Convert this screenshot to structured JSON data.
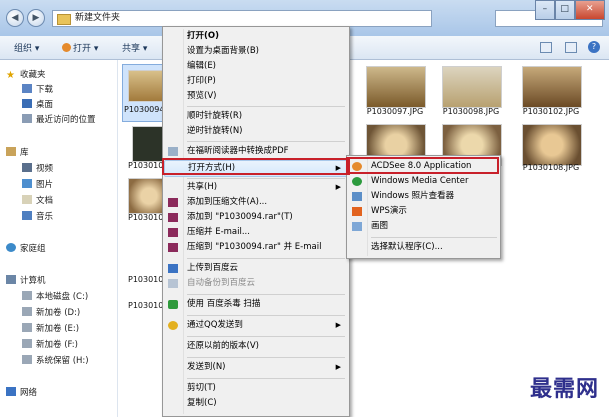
{
  "window": {
    "address": "新建文件夹",
    "back_glyph": "◀",
    "forward_glyph": "▶",
    "minimize_glyph": "–",
    "maximize_glyph": "□",
    "close_glyph": "✕"
  },
  "toolbar": {
    "organize": "组织 ▾",
    "open": "打开 ▾",
    "share": "共享 ▾"
  },
  "sidebar": {
    "favorites": "收藏夹",
    "downloads": "下载",
    "desktop": "桌面",
    "recent": "最近访问的位置",
    "libraries": "库",
    "videos": "视频",
    "pictures": "图片",
    "documents": "文档",
    "music": "音乐",
    "homegroup": "家庭组",
    "computer": "计算机",
    "drive_c": "本地磁盘 (C:)",
    "drive_d": "新加卷 (D:)",
    "drive_e": "新加卷 (E:)",
    "drive_f": "新加卷 (F:)",
    "drive_h": "系统保留 (H:)",
    "network": "网络"
  },
  "files": {
    "f1": "P1030094.JPG",
    "f2": "P1030097.JPG",
    "f3": "P1030098.JPG",
    "f4": "P1030102.JPG",
    "f5": "P103010",
    "f6": "P1030108.JPG",
    "f7": "P103010",
    "f8": "P103010",
    "f9": "P103010"
  },
  "context_menu": {
    "open": "打开(O)",
    "set_bg": "设置为桌面背景(B)",
    "edit": "编辑(E)",
    "print": "打印(P)",
    "preview": "预览(V)",
    "rotate_cw": "顺时针旋转(R)",
    "rotate_ccw": "逆时针旋转(N)",
    "to_pdf": "在福昕阅读器中转换成PDF",
    "open_with": "打开方式(H)",
    "share": "共享(H)",
    "add_archive": "添加到压缩文件(A)...",
    "add_rar": "添加到 \"P1030094.rar\"(T)",
    "compress_email": "压缩并 E-mail...",
    "compress_rar_email": "压缩到 \"P1030094.rar\" 并 E-mail",
    "upload_baidu": "上传到百度云",
    "auto_backup": "自动备份到百度云",
    "baidu_scan": "使用 百度杀毒 扫描",
    "send_qq": "通过QQ发送到",
    "restore": "还原以前的版本(V)",
    "send_to": "发送到(N)",
    "cut": "剪切(T)",
    "copy": "复制(C)"
  },
  "submenu": {
    "acdsee": "ACDSee 8.0 Application",
    "wmc": "Windows Media Center",
    "photo_viewer": "Windows 照片查看器",
    "wps": "WPS演示",
    "paint": "画图",
    "choose_default": "选择默认程序(C)..."
  },
  "watermark": "最需网",
  "colors": {
    "highlight_red": "#c8202a",
    "accent_blue": "#3b73c3"
  }
}
